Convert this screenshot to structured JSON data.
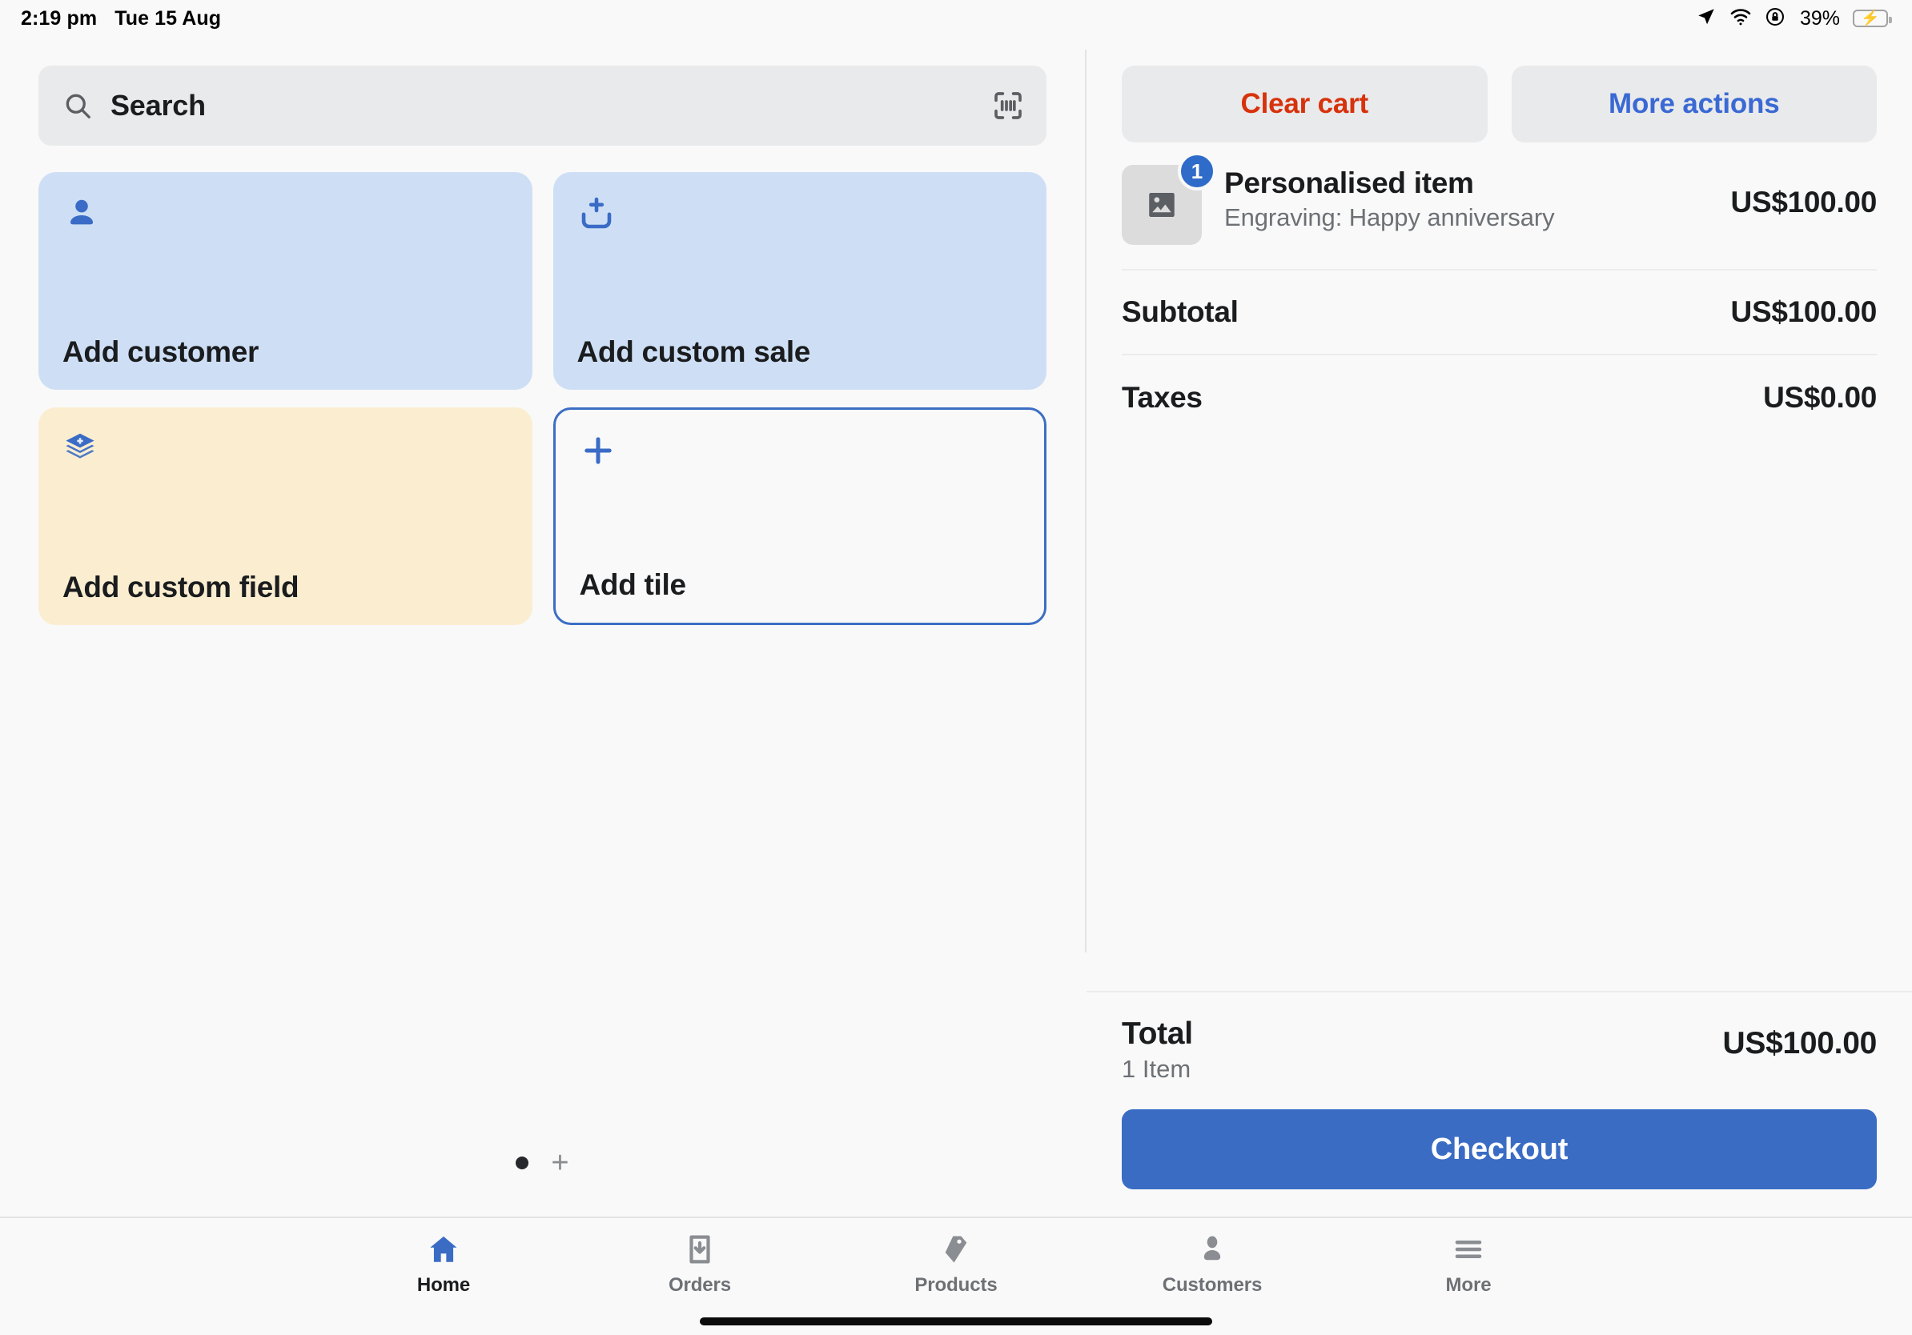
{
  "status_bar": {
    "time": "2:19 pm",
    "date": "Tue 15 Aug",
    "battery_percent": "39%",
    "icons": [
      "location-arrow-icon",
      "wifi-icon",
      "rotation-lock-icon",
      "battery-charging-icon"
    ]
  },
  "search": {
    "placeholder": "Search",
    "icon": "search-icon",
    "scan_icon": "barcode-scan-icon"
  },
  "tiles": [
    {
      "label": "Add customer",
      "icon": "person-icon",
      "style": "blue"
    },
    {
      "label": "Add custom sale",
      "icon": "cart-add-icon",
      "style": "blue"
    },
    {
      "label": "Add custom field",
      "icon": "layers-add-icon",
      "style": "cream"
    },
    {
      "label": "Add tile",
      "icon": "plus-icon",
      "style": "outline"
    }
  ],
  "page_indicator": {
    "dot": "•",
    "add": "+"
  },
  "cart": {
    "actions": {
      "clear_label": "Clear cart",
      "more_label": "More actions"
    },
    "items": [
      {
        "title": "Personalised item",
        "subtitle": "Engraving: Happy anniversary",
        "price": "US$100.00",
        "quantity": "1",
        "thumb_icon": "image-placeholder-icon"
      }
    ],
    "summary": [
      {
        "label": "Subtotal",
        "value": "US$100.00"
      },
      {
        "label": "Taxes",
        "value": "US$0.00"
      }
    ],
    "total": {
      "label": "Total",
      "count": "1 Item",
      "value": "US$100.00"
    },
    "checkout_label": "Checkout"
  },
  "tabbar": [
    {
      "label": "Home",
      "icon": "home-icon",
      "active": true
    },
    {
      "label": "Orders",
      "icon": "orders-inbox-icon",
      "active": false
    },
    {
      "label": "Products",
      "icon": "price-tag-icon",
      "active": false
    },
    {
      "label": "Customers",
      "icon": "person-icon",
      "active": false
    },
    {
      "label": "More",
      "icon": "hamburger-menu-icon",
      "active": false
    }
  ],
  "colors": {
    "accent_blue": "#3a6cc4",
    "danger_red": "#d7320c",
    "link_blue": "#3a69d4",
    "tile_blue": "#cedff5",
    "tile_cream": "#fbeed0",
    "badge_blue": "#2f6bc8",
    "battery_green": "#34c759"
  }
}
